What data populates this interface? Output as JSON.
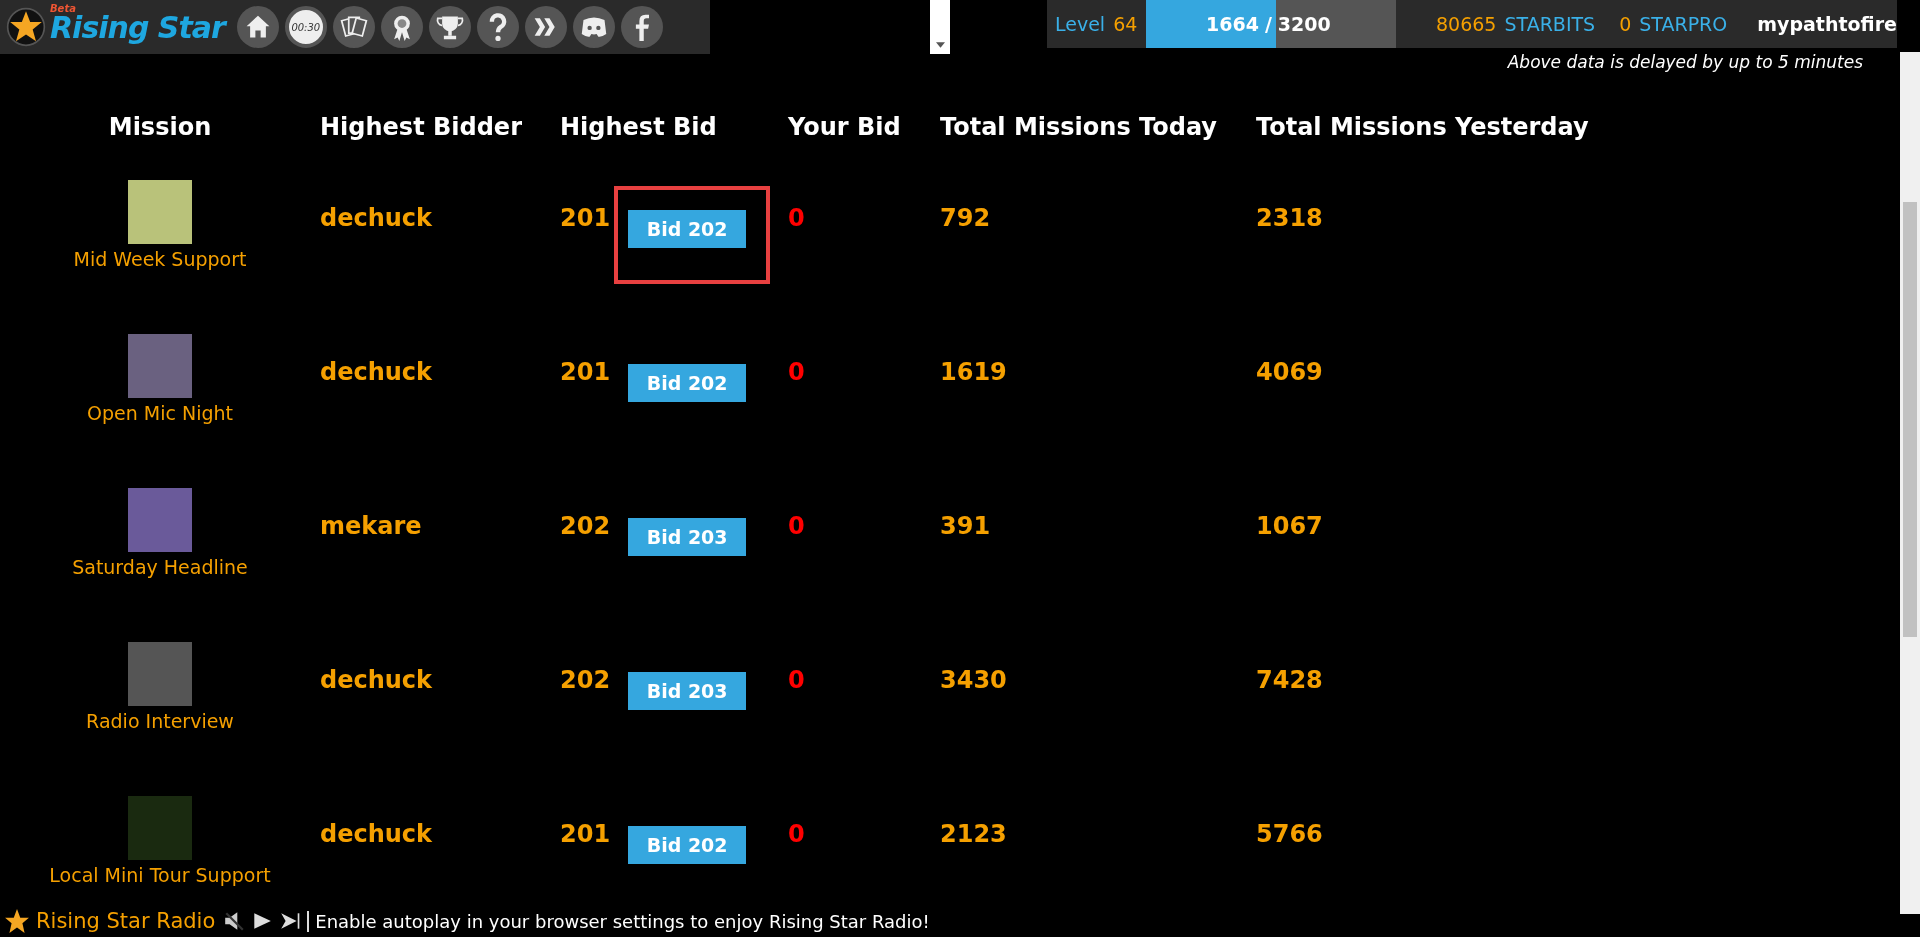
{
  "brand": {
    "name": "Rising Star",
    "tag": "Beta"
  },
  "toolbar": [
    {
      "kind": "home"
    },
    {
      "kind": "timer",
      "label": "00:30"
    },
    {
      "kind": "cards"
    },
    {
      "kind": "ribbon"
    },
    {
      "kind": "trophy"
    },
    {
      "kind": "help"
    },
    {
      "kind": "chevrons"
    },
    {
      "kind": "chat"
    },
    {
      "kind": "letter-f"
    }
  ],
  "stats": {
    "level_label": "Level",
    "level": "64",
    "xp": {
      "current": "1664",
      "separator": "/",
      "total": "3200",
      "level": 0.52
    },
    "starbits": "80665",
    "starbits_label": "STARBITS",
    "starpro": "0",
    "starpro_label": "STARPRO",
    "username": "mypathtofire",
    "notice": "Above data is delayed by up to 5 minutes"
  },
  "table": {
    "columns": [
      "Mission",
      "Highest Bidder",
      "Highest Bid",
      "Your Bid",
      "Total Missions Today",
      "Total Missions Yesterday"
    ],
    "rows": [
      {
        "mission": "Mid Week Support",
        "bidder": "dechuck",
        "highest_bid": "201",
        "bid_button": "Bid 202",
        "your_bid": "0",
        "today": "792",
        "yesterday": "2318",
        "highlighted": true
      },
      {
        "mission": "Open Mic Night",
        "bidder": "dechuck",
        "highest_bid": "201",
        "bid_button": "Bid 202",
        "your_bid": "0",
        "today": "1619",
        "yesterday": "4069",
        "highlighted": false
      },
      {
        "mission": "Saturday Headline",
        "bidder": "mekare",
        "highest_bid": "202",
        "bid_button": "Bid 203",
        "your_bid": "0",
        "today": "391",
        "yesterday": "1067",
        "highlighted": false
      },
      {
        "mission": "Radio Interview",
        "bidder": "dechuck",
        "highest_bid": "202",
        "bid_button": "Bid 203",
        "your_bid": "0",
        "today": "3430",
        "yesterday": "7428",
        "highlighted": false
      },
      {
        "mission": "Local Mini Tour Support",
        "bidder": "dechuck",
        "highest_bid": "201",
        "bid_button": "Bid 202",
        "your_bid": "0",
        "today": "2123",
        "yesterday": "5766",
        "highlighted": false
      }
    ]
  },
  "radio": {
    "title": "Rising Star Radio",
    "message": "Enable autoplay in your browser settings to enjoy Rising Star Radio!"
  }
}
